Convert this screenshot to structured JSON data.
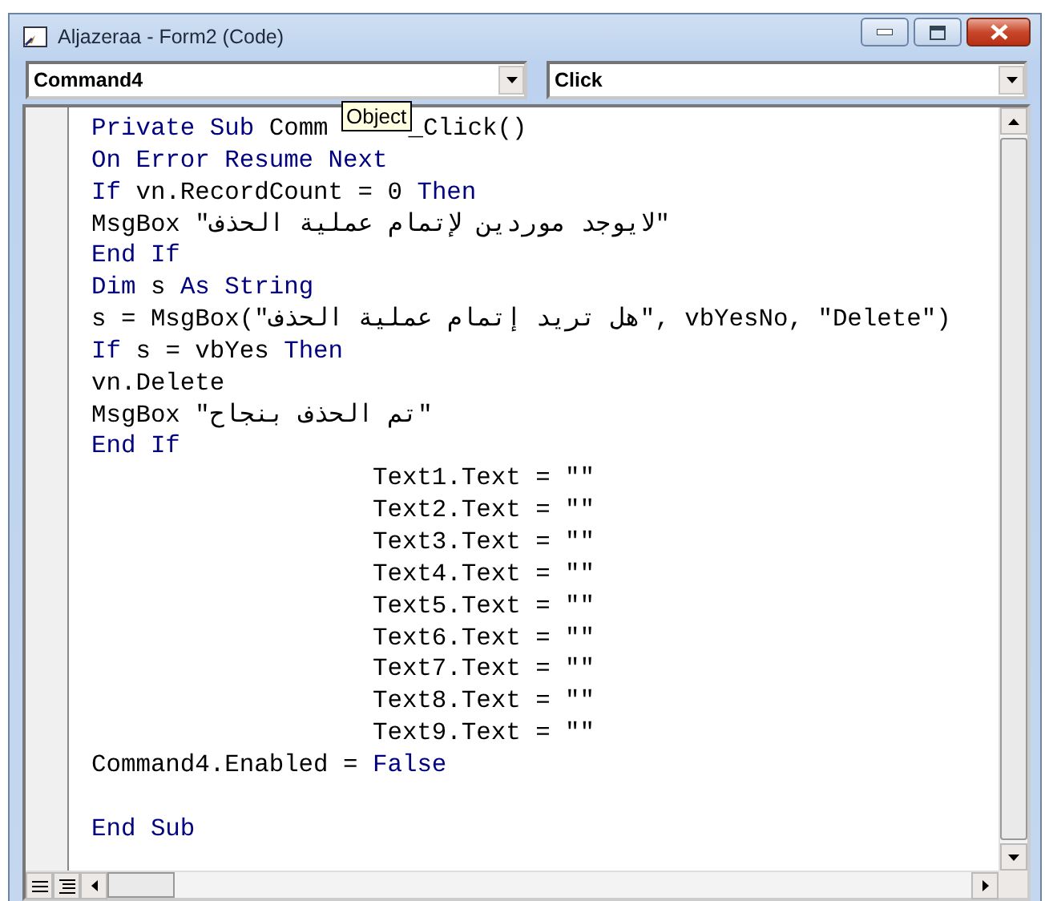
{
  "window": {
    "title": "Aljazeraa - Form2 (Code)"
  },
  "object_combo": {
    "value": "Command4"
  },
  "procedure_combo": {
    "value": "Click"
  },
  "tooltip": {
    "text": "Object"
  },
  "code_lines": [
    {
      "kind": "code",
      "indented": false,
      "tokens": [
        {
          "kind": "keyword",
          "text": "Private Sub "
        },
        {
          "kind": "plain",
          "text": "Comm"
        },
        {
          "kind": "plain",
          "text": "_Click()",
          "after_tooltip": true
        }
      ]
    },
    {
      "kind": "code",
      "indented": false,
      "tokens": [
        {
          "kind": "keyword",
          "text": "On Error Resume Next"
        }
      ]
    },
    {
      "kind": "code",
      "indented": false,
      "tokens": [
        {
          "kind": "keyword",
          "text": "If "
        },
        {
          "kind": "plain",
          "text": "vn.RecordCount = 0 "
        },
        {
          "kind": "keyword",
          "text": "Then"
        }
      ]
    },
    {
      "kind": "code",
      "indented": false,
      "tokens": [
        {
          "kind": "plain",
          "text": "MsgBox \"لايوجد موردين لإتمام عملية الحذف\""
        }
      ]
    },
    {
      "kind": "code",
      "indented": false,
      "tokens": [
        {
          "kind": "keyword",
          "text": "End If"
        }
      ]
    },
    {
      "kind": "code",
      "indented": false,
      "tokens": [
        {
          "kind": "keyword",
          "text": "Dim "
        },
        {
          "kind": "plain",
          "text": "s "
        },
        {
          "kind": "keyword",
          "text": "As String"
        }
      ]
    },
    {
      "kind": "code",
      "indented": false,
      "tokens": [
        {
          "kind": "plain",
          "text": "s = MsgBox(\"هل تريد إتمام عملية الحذف\", vbYesNo, \"Delete\")"
        }
      ]
    },
    {
      "kind": "code",
      "indented": false,
      "tokens": [
        {
          "kind": "keyword",
          "text": "If "
        },
        {
          "kind": "plain",
          "text": "s = vbYes "
        },
        {
          "kind": "keyword",
          "text": "Then"
        }
      ]
    },
    {
      "kind": "code",
      "indented": false,
      "tokens": [
        {
          "kind": "plain",
          "text": "vn.Delete"
        }
      ]
    },
    {
      "kind": "code",
      "indented": false,
      "tokens": [
        {
          "kind": "plain",
          "text": "MsgBox \"تم الحذف بنجاح\""
        }
      ]
    },
    {
      "kind": "code",
      "indented": false,
      "tokens": [
        {
          "kind": "keyword",
          "text": "End If"
        }
      ]
    },
    {
      "kind": "code",
      "indented": true,
      "tokens": [
        {
          "kind": "plain",
          "text": "Text1.Text = \"\""
        }
      ]
    },
    {
      "kind": "code",
      "indented": true,
      "tokens": [
        {
          "kind": "plain",
          "text": "Text2.Text = \"\""
        }
      ]
    },
    {
      "kind": "code",
      "indented": true,
      "tokens": [
        {
          "kind": "plain",
          "text": "Text3.Text = \"\""
        }
      ]
    },
    {
      "kind": "code",
      "indented": true,
      "tokens": [
        {
          "kind": "plain",
          "text": "Text4.Text = \"\""
        }
      ]
    },
    {
      "kind": "code",
      "indented": true,
      "tokens": [
        {
          "kind": "plain",
          "text": "Text5.Text = \"\""
        }
      ]
    },
    {
      "kind": "code",
      "indented": true,
      "tokens": [
        {
          "kind": "plain",
          "text": "Text6.Text = \"\""
        }
      ]
    },
    {
      "kind": "code",
      "indented": true,
      "tokens": [
        {
          "kind": "plain",
          "text": "Text7.Text = \"\""
        }
      ]
    },
    {
      "kind": "code",
      "indented": true,
      "tokens": [
        {
          "kind": "plain",
          "text": "Text8.Text = \"\""
        }
      ]
    },
    {
      "kind": "code",
      "indented": true,
      "tokens": [
        {
          "kind": "plain",
          "text": "Text9.Text = \"\""
        }
      ]
    },
    {
      "kind": "code",
      "indented": false,
      "tokens": [
        {
          "kind": "plain",
          "text": "Command4.Enabled = "
        },
        {
          "kind": "keyword",
          "text": "False"
        }
      ]
    },
    {
      "kind": "blank"
    },
    {
      "kind": "code",
      "indented": false,
      "tokens": [
        {
          "kind": "keyword",
          "text": "End Sub"
        }
      ]
    }
  ]
}
